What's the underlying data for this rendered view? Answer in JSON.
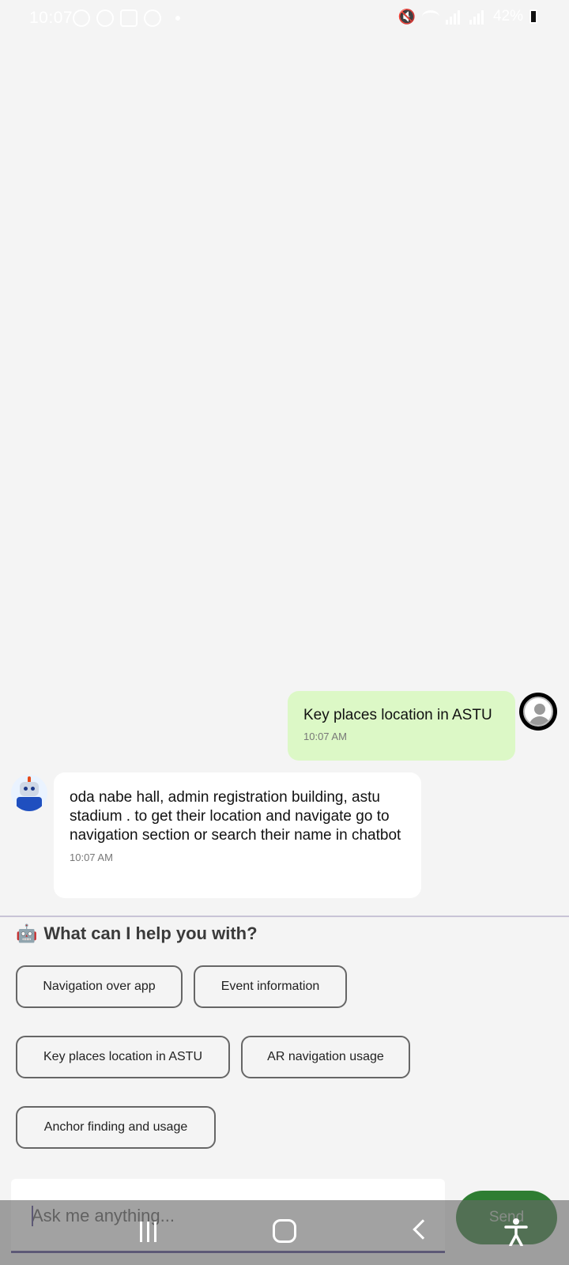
{
  "status_bar": {
    "time": "10:07",
    "battery": "42%"
  },
  "chat": {
    "messages": [
      {
        "sender": "user",
        "text": "Key places location in ASTU",
        "time": "10:07 AM"
      },
      {
        "sender": "bot",
        "text": "oda nabe hall, admin registration building, astu stadium . to get their location and navigate go to navigation section or search their name in chatbot",
        "time": "10:07 AM"
      }
    ]
  },
  "suggestions": {
    "title_emoji": "🤖",
    "title": "What can I help you with?",
    "chips": [
      {
        "label": "Navigation over app"
      },
      {
        "label": "Event information"
      },
      {
        "label": "Key places location in ASTU"
      },
      {
        "label": "AR navigation usage"
      },
      {
        "label": "Anchor finding and usage"
      }
    ]
  },
  "composer": {
    "placeholder": "Ask me anything...",
    "send_label": "Send"
  },
  "colors": {
    "user_bubble": "#dcf8c6",
    "bot_bubble": "#ffffff",
    "send_button": "#2e7d32",
    "accent_underline": "#4a3f8c"
  }
}
